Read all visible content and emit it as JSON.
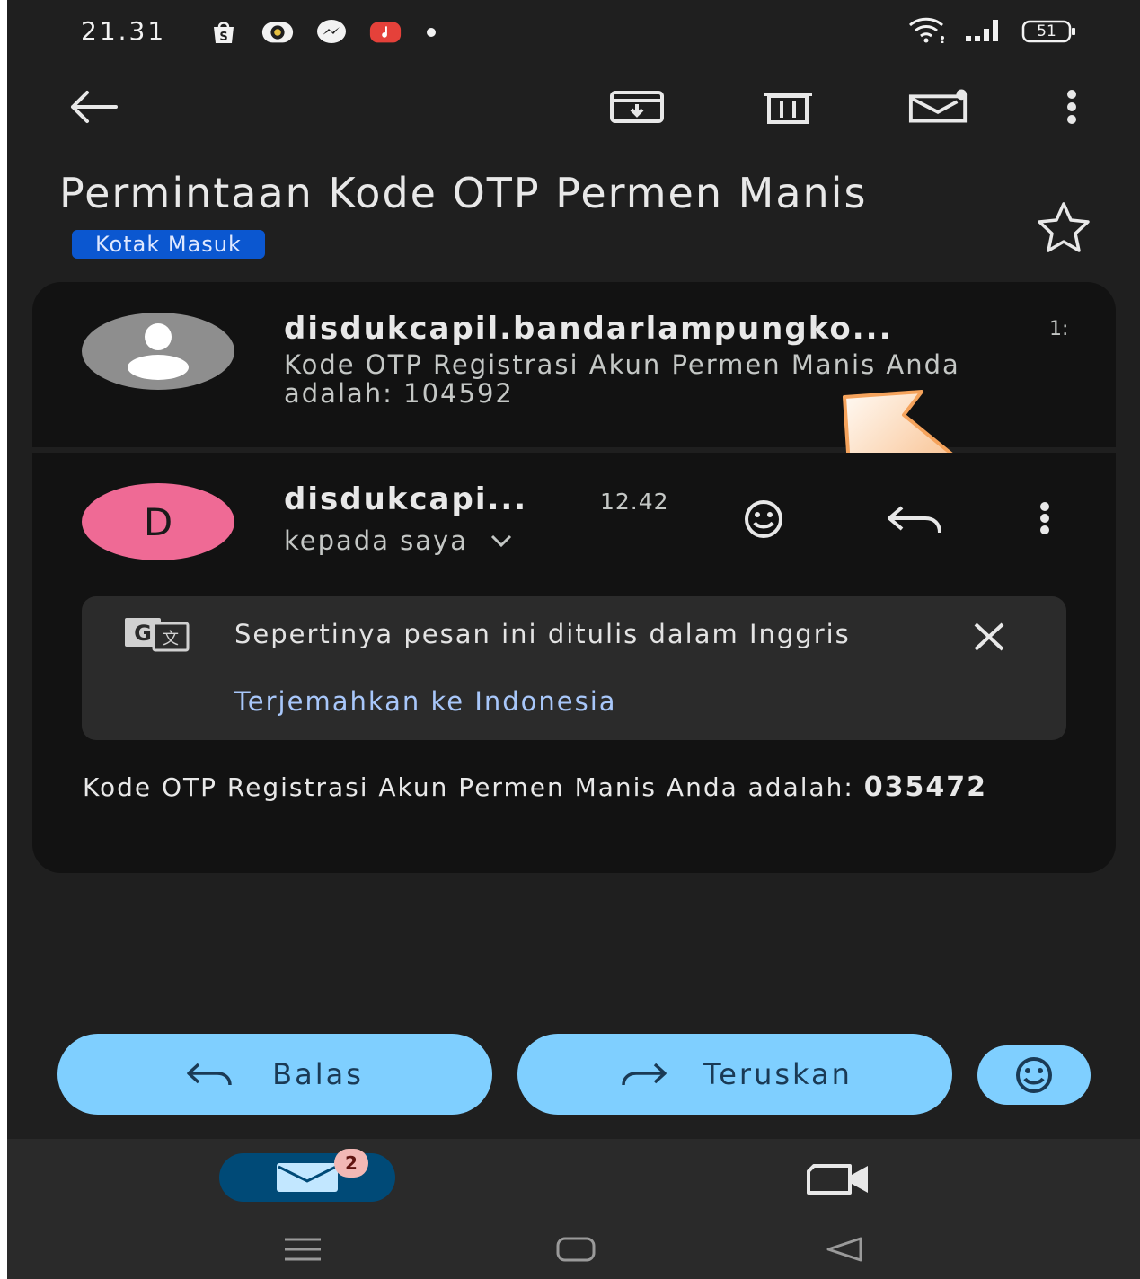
{
  "status_bar": {
    "time": "21.31",
    "battery": "51",
    "app_icons": [
      "shopee-icon",
      "capcut-icon",
      "messenger-icon",
      "music-icon"
    ]
  },
  "toolbar": {
    "icons": [
      "back-arrow-icon",
      "archive-icon",
      "delete-icon",
      "mark-unread-icon",
      "more-vert-icon"
    ]
  },
  "email": {
    "subject": "Permintaan Kode OTP Permen Manis",
    "label": "Kotak Masuk"
  },
  "previous_message": {
    "sender": "disdukcapil.bandarlampungko...",
    "time": "1:",
    "snippet": "Kode OTP Registrasi Akun Permen Manis Anda adalah: 104592"
  },
  "current_message": {
    "avatar_letter": "D",
    "sender": "disdukcapi...",
    "time": "12.42",
    "recipient": "kepada saya"
  },
  "translate_banner": {
    "message": "Sepertinya pesan ini ditulis dalam Inggris",
    "link": "Terjemahkan ke Indonesia"
  },
  "message_body": {
    "text_prefix": "Kode OTP Registrasi Akun Permen Manis Anda adalah: ",
    "code": "035472"
  },
  "actions": {
    "reply_label": "Balas",
    "forward_label": "Teruskan"
  },
  "bottom_nav": {
    "mail_badge": "2"
  },
  "colors": {
    "background": "#1f1f1f",
    "card": "#121212",
    "chip": "#0b57d0",
    "pill": "#7fcfff",
    "avatar_d": "#ef6a95",
    "link": "#a8c7fa",
    "arrow": "#f5a35c"
  }
}
